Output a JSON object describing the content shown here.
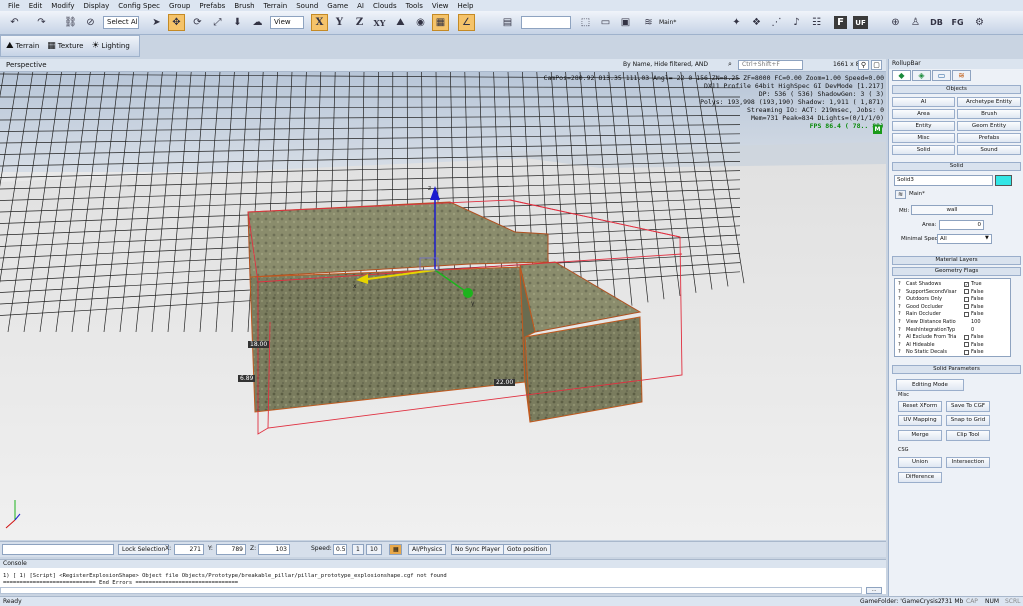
{
  "menu": [
    "File",
    "Edit",
    "Modify",
    "Display",
    "Config Spec",
    "Group",
    "Prefabs",
    "Brush",
    "Terrain",
    "Sound",
    "Game",
    "AI",
    "Clouds",
    "Tools",
    "View",
    "Help"
  ],
  "toolbar": {
    "select_all": "Select All",
    "view_select": "View",
    "axis_x": "X",
    "axis_y": "Y",
    "axis_z": "Z",
    "axis_xy": "XY",
    "layer_label": "Main*",
    "db": "DB",
    "fg": "FG",
    "f_btn": "F",
    "uf_btn": "UF"
  },
  "toolbar2": [
    "Terrain",
    "Texture",
    "Lighting"
  ],
  "viewport_header": {
    "title": "Perspective",
    "filter": "By Name, Hide filtered, AND",
    "search_placeholder": "Ctrl+Shift+F",
    "resolution": "1661 x 881"
  },
  "stats": [
    "CamPos=280.92 813.35 111.03 Angl=-22  0 156 ZN=0.25 ZF=8000 FC=0.00 Zoom=1.00 Speed=0.00",
    "DX11 Profile 64bit HighSpec GI DevMode           [1.217]",
    "DP:  536 ( 536) ShadowGen:    3 (  3)",
    "Polys: 193,998 (193,190) Shadow: 1,911 ( 1,871)",
    "Streaming IO: ACT: 219msec, Jobs: 0",
    "Mem=731 Peak=834 DLights=(0/1/1/0)"
  ],
  "fps": "FPS  86.4 ( 78.. 89)",
  "mode_badge": "M",
  "dimensions": {
    "height": "18.00",
    "depth": "6.89",
    "width": "22.00"
  },
  "gizmo_axes": {
    "x": "x",
    "y": "y",
    "z": "z"
  },
  "status_row": {
    "lock_selection": "Lock Selection",
    "x_label": "X:",
    "x_value": "271",
    "y_label": "Y:",
    "y_value": "789",
    "z_label": "Z:",
    "z_value": "103",
    "speed_label": "Speed:",
    "speed_value": "0.5",
    "speed_opts": [
      "1",
      "10"
    ],
    "ai_physics": "AI/Physics",
    "no_sync": "No Sync Player",
    "goto": "Goto position"
  },
  "console": {
    "title": "Console",
    "lines": [
      "1) [ 1)     [Script]    <RegisterExplosionShape> Object file Objects/Prototype/breakable_pillar/pillar_prototype_explosionshape.cgf not found",
      "============================ End Errors ==============================="
    ],
    "more_btn": "..."
  },
  "bottom": {
    "status": "Ready",
    "game_folder": "GameFolder: 'GameCrysis2'",
    "mem": "731 Mb",
    "cap": "CAP",
    "num": "NUM",
    "scrl": "SCRL"
  },
  "rollup": {
    "title": "RollupBar",
    "objects_header": "Objects",
    "object_buttons": [
      "AI",
      "Archetype Entity",
      "Area",
      "Brush",
      "Entity",
      "Geom Entity",
      "Misc",
      "Prefabs",
      "Solid",
      "Sound"
    ],
    "solid_header": "Solid",
    "solid_name": "Solid3",
    "solid_color": "#33e6e6",
    "layer": "Main*",
    "mtl_label": "Mtl:",
    "mtl_value": "wall",
    "area_label": "Area:",
    "area_value": "0",
    "minspec_label": "Minimal Spec:",
    "minspec_value": "All",
    "material_layers": "Material Layers",
    "geometry_flags": "Geometry Flags",
    "flags": [
      {
        "name": "Cast Shadows",
        "value": "True",
        "checked": true
      },
      {
        "name": "SupportSecondVisar",
        "value": "False",
        "checked": false
      },
      {
        "name": "Outdoors Only",
        "value": "False",
        "checked": false
      },
      {
        "name": "Good Occluder",
        "value": "False",
        "checked": false
      },
      {
        "name": "Rain Occluder",
        "value": "False",
        "checked": false
      },
      {
        "name": "View Distance Ratio",
        "value": "100",
        "checked": null
      },
      {
        "name": "MeshIntegrationTyp",
        "value": "0",
        "checked": null
      },
      {
        "name": "AI Exclude From Tria",
        "value": "False",
        "checked": false
      },
      {
        "name": "AI Hideable",
        "value": "False",
        "checked": false
      },
      {
        "name": "No Static Decals",
        "value": "False",
        "checked": false
      }
    ],
    "solid_parameters": "Solid Parameters",
    "editing_mode": "Editing Mode",
    "misc_label": "Misc",
    "misc_buttons": [
      "Reset XForm",
      "Save To CGF",
      "UV Mapping",
      "Snap to Grid",
      "Merge",
      "Clip Tool"
    ],
    "csg_label": "CSG",
    "csg_buttons": [
      "Union",
      "Intersection",
      "Difference"
    ]
  },
  "colors": {
    "accent": "#f5c36a",
    "fps": "#0a8a0a",
    "gizmo_x": "#e6d400",
    "gizmo_y": "#1db31d",
    "gizmo_z": "#1c1ccf"
  }
}
